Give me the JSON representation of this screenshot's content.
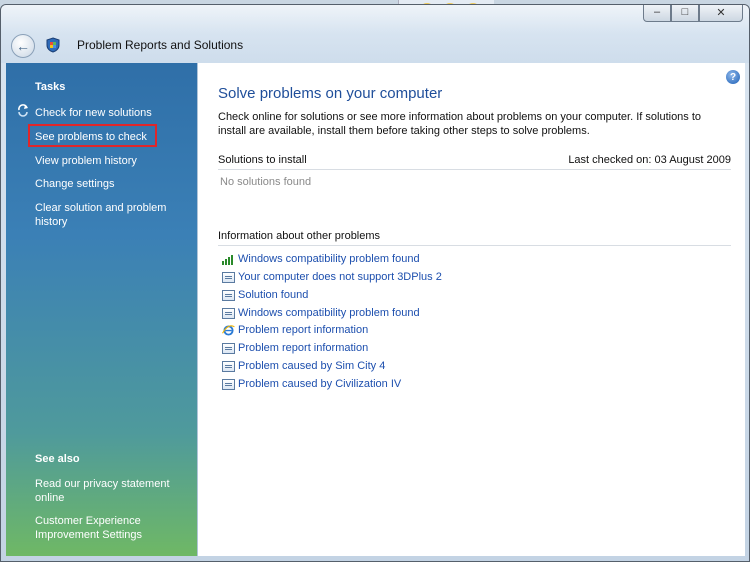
{
  "window": {
    "title": "Problem Reports and Solutions"
  },
  "left": {
    "tasks_heading": "Tasks",
    "tasks": [
      "Check for new solutions",
      "See problems to check",
      "View problem history",
      "Change settings",
      "Clear solution and problem history"
    ],
    "see_also_heading": "See also",
    "see_also": [
      "Read our privacy statement online",
      "Customer Experience Improvement Settings"
    ]
  },
  "main": {
    "heading": "Solve problems on your computer",
    "description": "Check online for solutions or see more information about problems on your computer. If solutions to install are available, install them before taking other steps to solve problems.",
    "solutions_label": "Solutions to install",
    "last_checked": "Last checked on: 03 August 2009",
    "no_solutions": "No solutions found",
    "other_label": "Information about other problems",
    "problems": [
      {
        "label": "Windows compatibility problem found",
        "icon": "signal-icon"
      },
      {
        "label": "Your computer does not support 3DPlus 2",
        "icon": "document-icon"
      },
      {
        "label": "Solution found",
        "icon": "document-icon"
      },
      {
        "label": "Windows compatibility problem found",
        "icon": "document-icon"
      },
      {
        "label": "Problem report information",
        "icon": "internet-explorer-icon"
      },
      {
        "label": "Problem report information",
        "icon": "document-icon"
      },
      {
        "label": "Problem caused by Sim City 4",
        "icon": "document-icon"
      },
      {
        "label": "Problem caused by Civilization IV",
        "icon": "document-icon"
      }
    ]
  },
  "colors": {
    "link": "#1d4fae",
    "heading": "#1f4e9a",
    "highlight_border": "#e0262a"
  }
}
